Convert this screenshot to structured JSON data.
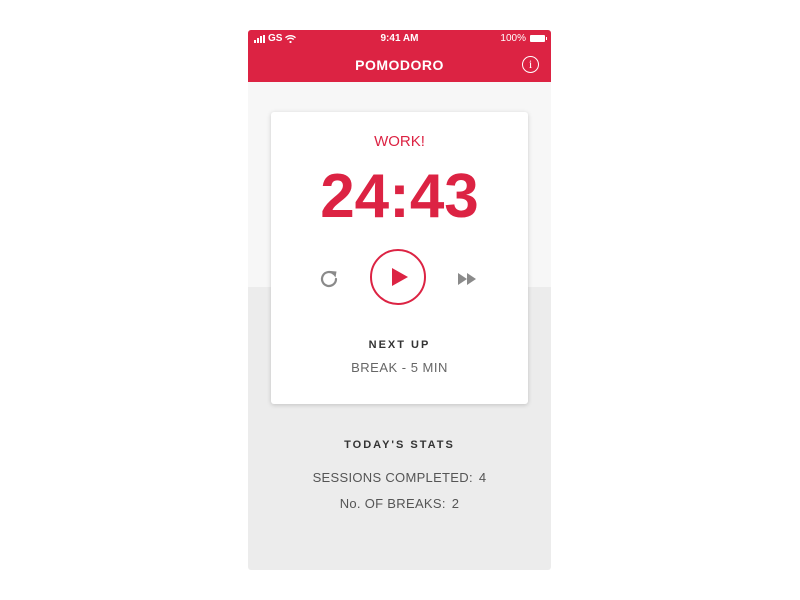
{
  "status_bar": {
    "carrier": "GS",
    "time": "9:41 AM",
    "battery": "100%"
  },
  "header": {
    "title": "POMODORO",
    "info_glyph": "i"
  },
  "timer": {
    "mode": "WORK!",
    "time": "24:43"
  },
  "next_up": {
    "label": "NEXT UP",
    "value": "BREAK - 5 MIN"
  },
  "stats": {
    "title": "TODAY'S STATS",
    "sessions_label": "SESSIONS COMPLETED:",
    "sessions_value": "4",
    "breaks_label": "No. OF BREAKS:",
    "breaks_value": "2"
  },
  "icons": {
    "signal": "signal-icon",
    "wifi": "wifi-icon",
    "battery": "battery-icon",
    "info": "info-icon",
    "reset": "refresh-icon",
    "play": "play-icon",
    "skip": "fast-forward-icon"
  },
  "colors": {
    "accent": "#dc2343",
    "background": "#ececec",
    "card": "#ffffff"
  }
}
